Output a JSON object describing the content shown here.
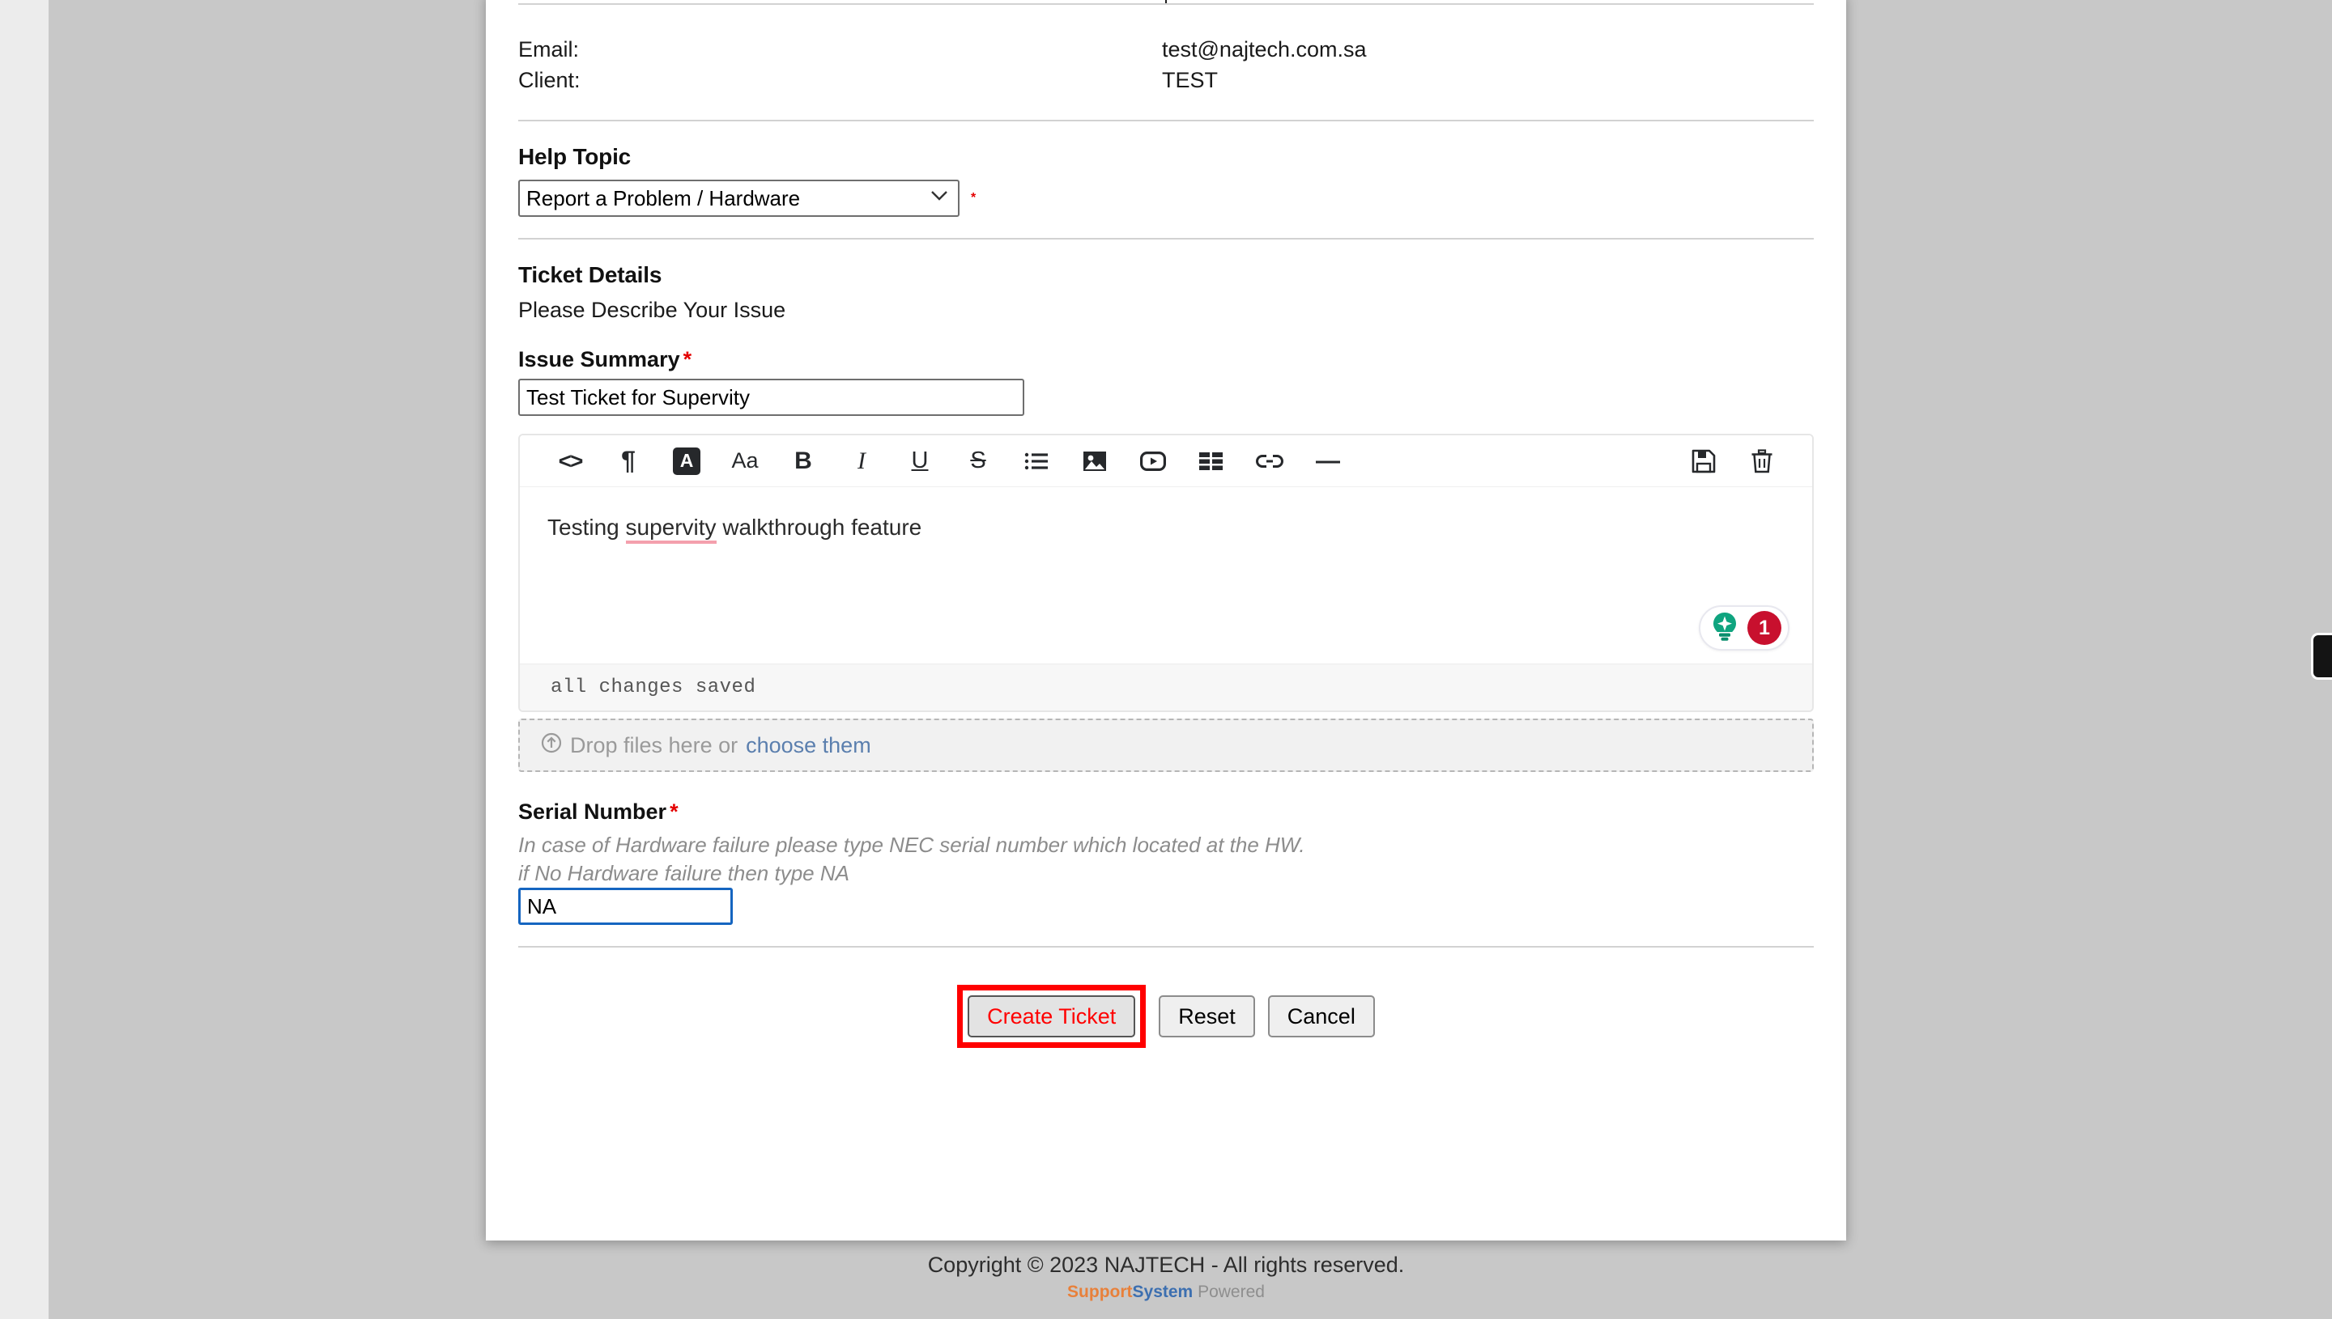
{
  "page": {
    "clipped_top_text": "|"
  },
  "info": {
    "rows": [
      {
        "label": "Email:",
        "value": "test@najtech.com.sa"
      },
      {
        "label": "Client:",
        "value": "TEST"
      }
    ]
  },
  "help_topic": {
    "title": "Help Topic",
    "selected": "Report a Problem / Hardware",
    "required_mark": "*",
    "options": [
      "Report a Problem / Hardware"
    ]
  },
  "ticket_details": {
    "title": "Ticket Details",
    "subtitle": "Please Describe Your Issue",
    "issue_summary": {
      "label": "Issue Summary",
      "required_mark": "*",
      "value": "Test Ticket for Supervity"
    }
  },
  "editor": {
    "toolbar": [
      {
        "name": "code-icon",
        "glyph": "<>"
      },
      {
        "name": "paragraph-icon",
        "glyph": "¶"
      },
      {
        "name": "text-color-icon",
        "glyph": "A"
      },
      {
        "name": "font-size-icon",
        "glyph": "Aa"
      },
      {
        "name": "bold-icon",
        "glyph": "B"
      },
      {
        "name": "italic-icon",
        "glyph": "I"
      },
      {
        "name": "underline-icon",
        "glyph": "U"
      },
      {
        "name": "strikethrough-icon",
        "glyph": "S"
      },
      {
        "name": "bullet-list-icon",
        "glyph": "list"
      },
      {
        "name": "image-icon",
        "glyph": "image"
      },
      {
        "name": "video-icon",
        "glyph": "video"
      },
      {
        "name": "table-icon",
        "glyph": "table"
      },
      {
        "name": "link-icon",
        "glyph": "link"
      },
      {
        "name": "horizontal-rule-icon",
        "glyph": "—"
      }
    ],
    "toolbar_right": [
      {
        "name": "save-icon",
        "glyph": "floppy"
      },
      {
        "name": "delete-icon",
        "glyph": "trash"
      }
    ],
    "body_text_before": "Testing ",
    "body_text_misspelled": "supervity",
    "body_text_after": " walkthrough feature",
    "grammarly_count": "1",
    "status": "all changes saved"
  },
  "dropzone": {
    "icon": "upload-circle-icon",
    "text": "Drop files here or",
    "link": "choose them"
  },
  "serial_number": {
    "label": "Serial Number",
    "required_mark": "*",
    "hint_line_1": "In case of Hardware failure please type NEC serial number which located at the HW.",
    "hint_line_2": "if No Hardware failure then type NA",
    "value": "NA"
  },
  "actions": {
    "create": "Create Ticket",
    "reset": "Reset",
    "cancel": "Cancel"
  },
  "footer": {
    "copyright": "Copyright © 2023 NAJTECH - All rights reserved.",
    "brand_support": "Support",
    "brand_system": "System",
    "brand_powered": "Powered"
  },
  "colors": {
    "required_red": "#e40000",
    "highlight_red": "#ff0000",
    "focus_blue": "#1565c0",
    "link_blue": "#5b7fae",
    "grammarly_green": "#0fa47f",
    "grammarly_badge": "#c8102e",
    "brand_orange": "#e8803a",
    "brand_blue": "#3c6fb0"
  }
}
